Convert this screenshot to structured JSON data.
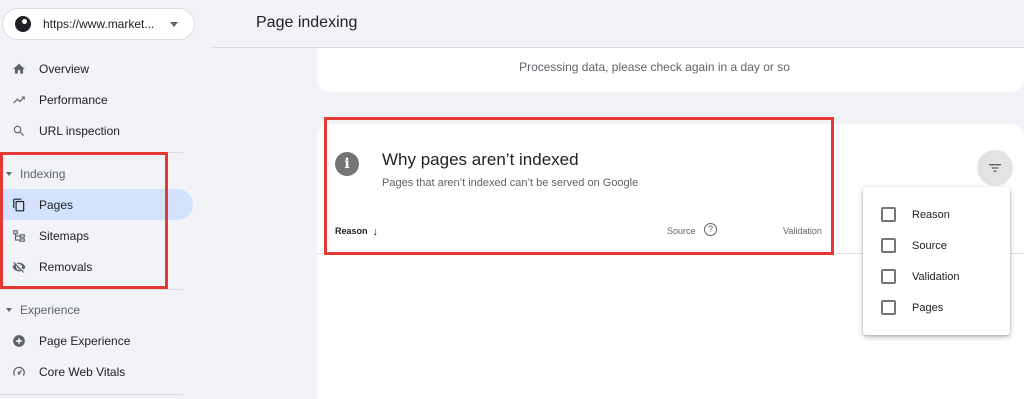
{
  "property": {
    "url": "https://www.market..."
  },
  "nav": {
    "overview": "Overview",
    "performance": "Performance",
    "url_inspection": "URL inspection",
    "indexing_section": "Indexing",
    "pages": "Pages",
    "sitemaps": "Sitemaps",
    "removals": "Removals",
    "experience_section": "Experience",
    "page_experience": "Page Experience",
    "core_web_vitals": "Core Web Vitals"
  },
  "header": {
    "title": "Page indexing"
  },
  "processing": {
    "message": "Processing data, please check again in a day or so"
  },
  "why_card": {
    "title": "Why pages aren’t indexed",
    "subtitle": "Pages that aren’t indexed can’t be served on Google",
    "columns": {
      "reason": "Reason",
      "source": "Source",
      "validation": "Validation"
    }
  },
  "filter_menu": {
    "items": [
      "Reason",
      "Source",
      "Validation",
      "Pages"
    ]
  },
  "colors": {
    "active_nav": "#d3e3fd",
    "highlight": "#e53935",
    "background": "#f1f3f7"
  }
}
